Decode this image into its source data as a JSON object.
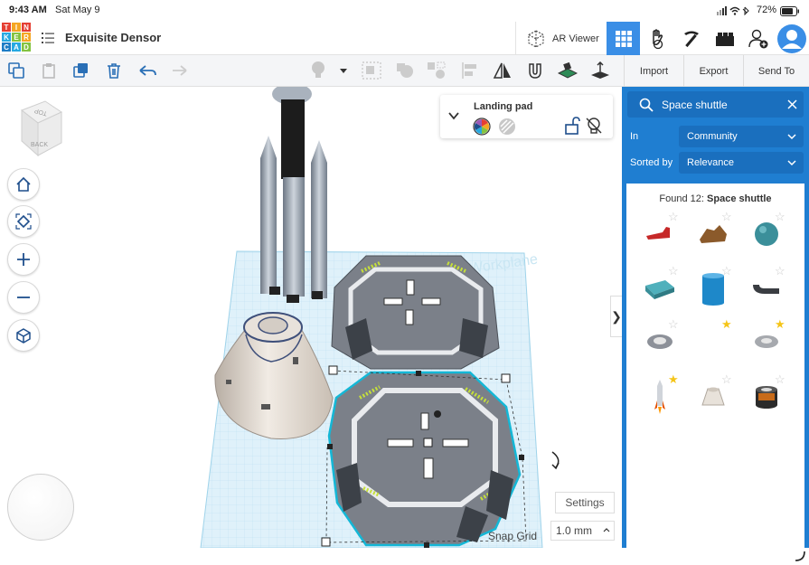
{
  "status_bar": {
    "time": "9:43 AM",
    "date": "Sat May 9",
    "battery": "72%"
  },
  "app": {
    "logo_letters": [
      "T",
      "I",
      "N",
      "K",
      "E",
      "R",
      "C",
      "A",
      "D"
    ],
    "title": "Exquisite Densor",
    "ar_viewer_label": "AR Viewer"
  },
  "toolbar": {
    "import_label": "Import",
    "export_label": "Export",
    "send_to_label": "Send To"
  },
  "inspector": {
    "shape_name": "Landing pad"
  },
  "viewcube": {
    "top_label": "TOP",
    "back_label": "BACK"
  },
  "workplane": {
    "label": "Workplane"
  },
  "viewport": {
    "settings_label": "Settings",
    "snap_grid_label": "Snap Grid",
    "snap_grid_value": "1.0 mm"
  },
  "search_panel": {
    "query": "Space shuttle",
    "in_label": "In",
    "in_value": "Community",
    "sorted_label": "Sorted by",
    "sorted_value": "Relevance",
    "found_prefix": "Found 12:",
    "found_query": "Space shuttle",
    "results": [
      {
        "icon": "red-shuttle-shape-icon",
        "starred": false
      },
      {
        "icon": "brown-rock-shape-icon",
        "starred": false
      },
      {
        "icon": "teal-sphere-shape-icon",
        "starred": false
      },
      {
        "icon": "teal-box-shape-icon",
        "starred": false
      },
      {
        "icon": "blue-cylinder-shape-icon",
        "starred": false
      },
      {
        "icon": "dark-tube-shape-icon",
        "starred": false
      },
      {
        "icon": "gray-pad-shape-icon",
        "starred": false
      },
      {
        "icon": "empty-shape-icon",
        "starred": true
      },
      {
        "icon": "gray-ring-shape-icon",
        "starred": true
      },
      {
        "icon": "rocket-shape-icon",
        "starred": true
      },
      {
        "icon": "capsule-shape-icon",
        "starred": false
      },
      {
        "icon": "dark-drum-shape-icon",
        "starred": false
      }
    ]
  },
  "colors": {
    "accent": "#1f7ed1",
    "active_tab": "#3a8ee6",
    "selection": "#14b7d6"
  }
}
